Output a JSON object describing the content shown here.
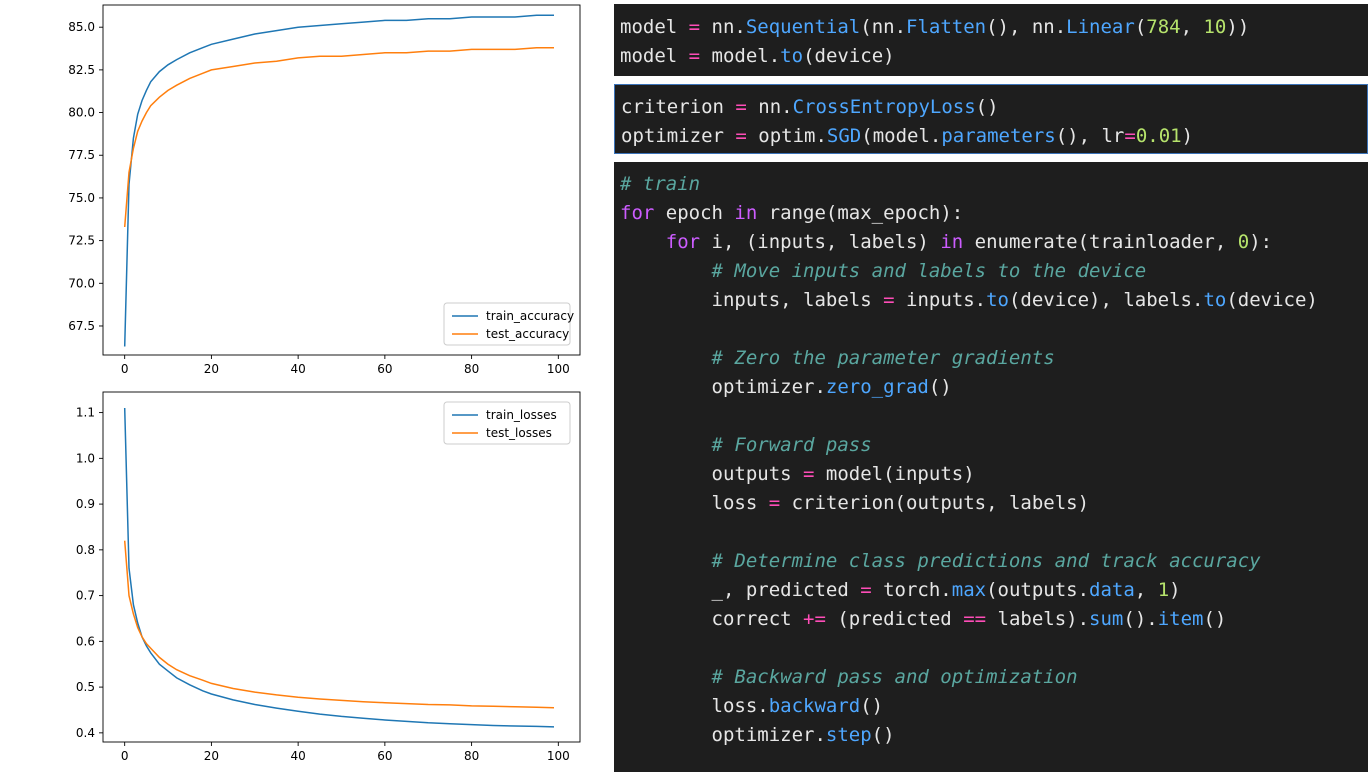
{
  "colors": {
    "train": "#1f77b4",
    "test": "#ff7f0e",
    "code_bg": "#1e1e1e"
  },
  "chart_data": [
    {
      "type": "line",
      "title": "",
      "xlabel": "",
      "ylabel": "",
      "xlim": [
        -5,
        105
      ],
      "ylim": [
        65.8,
        86.3
      ],
      "xticks": [
        "0",
        "20",
        "40",
        "60",
        "80",
        "100"
      ],
      "yticks": [
        "67.5",
        "70.0",
        "72.5",
        "75.0",
        "77.5",
        "80.0",
        "82.5",
        "85.0"
      ],
      "legend_position": "lower right",
      "x": [
        0,
        1,
        2,
        3,
        4,
        5,
        6,
        8,
        10,
        12,
        15,
        18,
        20,
        25,
        30,
        35,
        40,
        45,
        50,
        55,
        60,
        65,
        70,
        75,
        80,
        85,
        90,
        95,
        99
      ],
      "series": [
        {
          "name": "train_accuracy",
          "values": [
            66.3,
            75.8,
            78.5,
            79.9,
            80.7,
            81.3,
            81.8,
            82.4,
            82.8,
            83.1,
            83.5,
            83.8,
            84.0,
            84.3,
            84.6,
            84.8,
            85.0,
            85.1,
            85.2,
            85.3,
            85.4,
            85.4,
            85.5,
            85.5,
            85.6,
            85.6,
            85.6,
            85.7,
            85.7
          ]
        },
        {
          "name": "test_accuracy",
          "values": [
            73.3,
            76.5,
            77.9,
            78.9,
            79.5,
            80.0,
            80.4,
            80.9,
            81.3,
            81.6,
            82.0,
            82.3,
            82.5,
            82.7,
            82.9,
            83.0,
            83.2,
            83.3,
            83.3,
            83.4,
            83.5,
            83.5,
            83.6,
            83.6,
            83.7,
            83.7,
            83.7,
            83.8,
            83.8
          ]
        }
      ]
    },
    {
      "type": "line",
      "title": "",
      "xlabel": "",
      "ylabel": "",
      "xlim": [
        -5,
        105
      ],
      "ylim": [
        0.38,
        1.145
      ],
      "xticks": [
        "0",
        "20",
        "40",
        "60",
        "80",
        "100"
      ],
      "yticks": [
        "0.4",
        "0.5",
        "0.6",
        "0.7",
        "0.8",
        "0.9",
        "1.0",
        "1.1"
      ],
      "legend_position": "upper right",
      "x": [
        0,
        1,
        2,
        3,
        4,
        5,
        6,
        8,
        10,
        12,
        15,
        18,
        20,
        25,
        30,
        35,
        40,
        45,
        50,
        55,
        60,
        65,
        70,
        75,
        80,
        85,
        90,
        95,
        99
      ],
      "series": [
        {
          "name": "train_losses",
          "values": [
            1.11,
            0.76,
            0.68,
            0.64,
            0.61,
            0.59,
            0.575,
            0.55,
            0.535,
            0.52,
            0.505,
            0.492,
            0.485,
            0.472,
            0.462,
            0.454,
            0.447,
            0.441,
            0.436,
            0.432,
            0.428,
            0.425,
            0.422,
            0.42,
            0.418,
            0.416,
            0.415,
            0.414,
            0.413
          ]
        },
        {
          "name": "test_losses",
          "values": [
            0.82,
            0.7,
            0.66,
            0.63,
            0.61,
            0.595,
            0.585,
            0.565,
            0.55,
            0.538,
            0.525,
            0.515,
            0.508,
            0.497,
            0.489,
            0.483,
            0.478,
            0.474,
            0.471,
            0.468,
            0.466,
            0.464,
            0.462,
            0.461,
            0.459,
            0.458,
            0.457,
            0.456,
            0.455
          ]
        }
      ]
    }
  ],
  "code_cells": [
    [
      [
        [
          "",
          "model "
        ],
        [
          "op",
          "="
        ],
        [
          "",
          " nn."
        ],
        [
          "fn",
          "Sequential"
        ],
        [
          "",
          "(nn."
        ],
        [
          "fn",
          "Flatten"
        ],
        [
          "",
          "(), nn."
        ],
        [
          "fn",
          "Linear"
        ],
        [
          "",
          "("
        ],
        [
          "num",
          "784"
        ],
        [
          "",
          ", "
        ],
        [
          "num",
          "10"
        ],
        [
          "",
          "))"
        ]
      ],
      [
        [
          "",
          "model "
        ],
        [
          "op",
          "="
        ],
        [
          "",
          " model."
        ],
        [
          "fn",
          "to"
        ],
        [
          "",
          "(device)"
        ]
      ]
    ],
    [
      [
        [
          "",
          "criterion "
        ],
        [
          "op",
          "="
        ],
        [
          "",
          " nn."
        ],
        [
          "fn",
          "CrossEntropyLoss"
        ],
        [
          "",
          "()"
        ]
      ],
      [
        [
          "",
          "optimizer "
        ],
        [
          "op",
          "="
        ],
        [
          "",
          " optim."
        ],
        [
          "fn",
          "SGD"
        ],
        [
          "",
          "(model."
        ],
        [
          "fn",
          "parameters"
        ],
        [
          "",
          "(), lr"
        ],
        [
          "op",
          "="
        ],
        [
          "num",
          "0.01"
        ],
        [
          "",
          ")"
        ]
      ]
    ],
    [
      [
        [
          "cm",
          "# train"
        ]
      ],
      [
        [
          "kw",
          "for"
        ],
        [
          "",
          " epoch "
        ],
        [
          "kw",
          "in"
        ],
        [
          "",
          " range(max_epoch):"
        ]
      ],
      [
        [
          "",
          "    "
        ],
        [
          "kw",
          "for"
        ],
        [
          "",
          " i, (inputs, labels) "
        ],
        [
          "kw",
          "in"
        ],
        [
          "",
          " enumerate(trainloader, "
        ],
        [
          "num",
          "0"
        ],
        [
          "",
          "):"
        ]
      ],
      [
        [
          "",
          "        "
        ],
        [
          "cm",
          "# Move inputs and labels to the device"
        ]
      ],
      [
        [
          "",
          "        inputs, labels "
        ],
        [
          "op",
          "="
        ],
        [
          "",
          " inputs."
        ],
        [
          "fn",
          "to"
        ],
        [
          "",
          "(device), labels."
        ],
        [
          "fn",
          "to"
        ],
        [
          "",
          "(device)"
        ]
      ],
      [
        [
          "",
          ""
        ]
      ],
      [
        [
          "",
          "        "
        ],
        [
          "cm",
          "# Zero the parameter gradients"
        ]
      ],
      [
        [
          "",
          "        optimizer."
        ],
        [
          "fn",
          "zero_grad"
        ],
        [
          "",
          "()"
        ]
      ],
      [
        [
          "",
          ""
        ]
      ],
      [
        [
          "",
          "        "
        ],
        [
          "cm",
          "# Forward pass"
        ]
      ],
      [
        [
          "",
          "        outputs "
        ],
        [
          "op",
          "="
        ],
        [
          "",
          " model(inputs)"
        ]
      ],
      [
        [
          "",
          "        loss "
        ],
        [
          "op",
          "="
        ],
        [
          "",
          " criterion(outputs, labels)"
        ]
      ],
      [
        [
          "",
          ""
        ]
      ],
      [
        [
          "",
          "        "
        ],
        [
          "cm",
          "# Determine class predictions and track accuracy"
        ]
      ],
      [
        [
          "",
          "        _, predicted "
        ],
        [
          "op",
          "="
        ],
        [
          "",
          " torch."
        ],
        [
          "fn",
          "max"
        ],
        [
          "",
          "(outputs."
        ],
        [
          "fn",
          "data"
        ],
        [
          "",
          ", "
        ],
        [
          "num",
          "1"
        ],
        [
          "",
          ")"
        ]
      ],
      [
        [
          "",
          "        correct "
        ],
        [
          "op",
          "+="
        ],
        [
          "",
          " (predicted "
        ],
        [
          "op",
          "=="
        ],
        [
          "",
          " labels)."
        ],
        [
          "fn",
          "sum"
        ],
        [
          "",
          "()."
        ],
        [
          "fn",
          "item"
        ],
        [
          "",
          "()"
        ]
      ],
      [
        [
          "",
          ""
        ]
      ],
      [
        [
          "",
          "        "
        ],
        [
          "cm",
          "# Backward pass and optimization"
        ]
      ],
      [
        [
          "",
          "        loss."
        ],
        [
          "fn",
          "backward"
        ],
        [
          "",
          "()"
        ]
      ],
      [
        [
          "",
          "        optimizer."
        ],
        [
          "fn",
          "step"
        ],
        [
          "",
          "()"
        ]
      ]
    ]
  ]
}
